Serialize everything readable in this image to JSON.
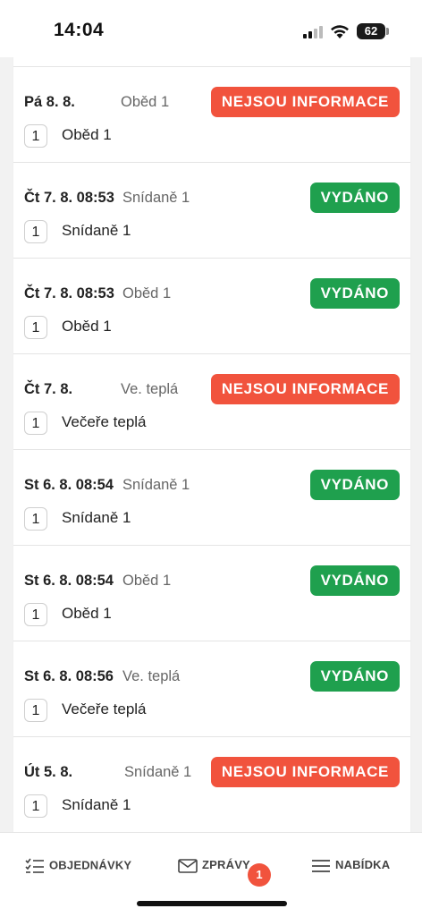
{
  "status": {
    "time": "14:04",
    "battery": "62"
  },
  "colors": {
    "issued": "#1fa04e",
    "no_info": "#f1533d"
  },
  "orders": [
    {
      "date": "Pá 8. 8.",
      "meal": "Oběd 1",
      "status": "NEJSOU INFORMACE",
      "status_type": "no_info",
      "qty": "1",
      "item": "Oběd 1"
    },
    {
      "date": "Čt 7. 8. 08:53",
      "meal": "Snídaně 1",
      "status": "VYDÁNO",
      "status_type": "issued",
      "qty": "1",
      "item": "Snídaně 1"
    },
    {
      "date": "Čt 7. 8. 08:53",
      "meal": "Oběd 1",
      "status": "VYDÁNO",
      "status_type": "issued",
      "qty": "1",
      "item": "Oběd 1"
    },
    {
      "date": "Čt 7. 8.",
      "meal": "Ve. teplá",
      "status": "NEJSOU INFORMACE",
      "status_type": "no_info",
      "qty": "1",
      "item": "Večeře teplá"
    },
    {
      "date": "St 6. 8. 08:54",
      "meal": "Snídaně 1",
      "status": "VYDÁNO",
      "status_type": "issued",
      "qty": "1",
      "item": "Snídaně 1"
    },
    {
      "date": "St 6. 8. 08:54",
      "meal": "Oběd 1",
      "status": "VYDÁNO",
      "status_type": "issued",
      "qty": "1",
      "item": "Oběd 1"
    },
    {
      "date": "St 6. 8. 08:56",
      "meal": "Ve. teplá",
      "status": "VYDÁNO",
      "status_type": "issued",
      "qty": "1",
      "item": "Večeře teplá"
    },
    {
      "date": "Út 5. 8.",
      "meal": "Snídaně 1",
      "status": "NEJSOU INFORMACE",
      "status_type": "no_info",
      "qty": "1",
      "item": "Snídaně 1"
    }
  ],
  "tabs": {
    "orders": {
      "label": "OBJEDNÁVKY",
      "icon": "checklist-icon"
    },
    "messages": {
      "label": "ZPRÁVY",
      "icon": "envelope-icon",
      "badge": "1"
    },
    "menu": {
      "label": "NABÍDKA",
      "icon": "hamburger-icon"
    }
  }
}
